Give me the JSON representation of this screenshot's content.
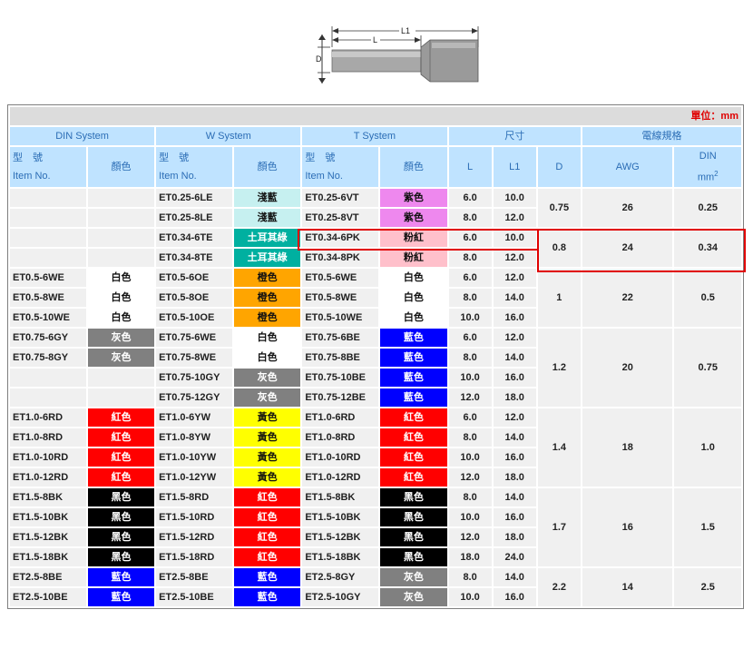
{
  "diagram": {
    "label_l1": "L1",
    "label_l": "L",
    "label_d": "D"
  },
  "table": {
    "unit": "單位：mm",
    "groups": {
      "din": "DIN System",
      "w": "W System",
      "t": "T System",
      "size": "尺寸",
      "wire": "電線規格"
    },
    "headers": {
      "item_zh": "型　號",
      "item_en": "Item No.",
      "color": "顏色",
      "L": "L",
      "L1": "L1",
      "D": "D",
      "awg": "AWG",
      "din": "DIN",
      "din_unit": "mm",
      "din_sup": "2"
    },
    "colors": {
      "浅藍": "#c6f0f0",
      "土耳其綠": "#00b0a0",
      "紫色": "#ee88ee",
      "粉紅": "#ffc0cb",
      "白色": "#ffffff",
      "橙色": "#ffa500",
      "灰色": "#808080",
      "藍色": "#0000ff",
      "紅色": "#ff0000",
      "黃色": "#ffff00",
      "黑色": "#000000"
    },
    "rows": [
      {
        "din": "",
        "din_c": "",
        "w": "ET0.25-6LE",
        "w_c": "淺藍",
        "t": "ET0.25-6VT",
        "t_c": "紫色",
        "L": "6.0",
        "L1": "10.0",
        "ck": "浅藍",
        "tk": "紫色"
      },
      {
        "din": "",
        "din_c": "",
        "w": "ET0.25-8LE",
        "w_c": "淺藍",
        "t": "ET0.25-8VT",
        "t_c": "紫色",
        "L": "8.0",
        "L1": "12.0",
        "ck": "浅藍",
        "tk": "紫色"
      },
      {
        "din": "",
        "din_c": "",
        "w": "ET0.34-6TE",
        "w_c": "土耳其綠",
        "t": "ET0.34-6PK",
        "t_c": "粉紅",
        "L": "6.0",
        "L1": "10.0",
        "ck": "土耳其綠",
        "tk": "粉紅"
      },
      {
        "din": "",
        "din_c": "",
        "w": "ET0.34-8TE",
        "w_c": "土耳其綠",
        "t": "ET0.34-8PK",
        "t_c": "粉紅",
        "L": "8.0",
        "L1": "12.0",
        "ck": "土耳其綠",
        "tk": "粉紅"
      },
      {
        "din": "ET0.5-6WE",
        "din_c": "白色",
        "w": "ET0.5-6OE",
        "w_c": "橙色",
        "t": "ET0.5-6WE",
        "t_c": "白色",
        "L": "6.0",
        "L1": "12.0",
        "dk": "白色",
        "ck": "橙色",
        "tk": "白色"
      },
      {
        "din": "ET0.5-8WE",
        "din_c": "白色",
        "w": "ET0.5-8OE",
        "w_c": "橙色",
        "t": "ET0.5-8WE",
        "t_c": "白色",
        "L": "8.0",
        "L1": "14.0",
        "dk": "白色",
        "ck": "橙色",
        "tk": "白色"
      },
      {
        "din": "ET0.5-10WE",
        "din_c": "白色",
        "w": "ET0.5-10OE",
        "w_c": "橙色",
        "t": "ET0.5-10WE",
        "t_c": "白色",
        "L": "10.0",
        "L1": "16.0",
        "dk": "白色",
        "ck": "橙色",
        "tk": "白色"
      },
      {
        "din": "ET0.75-6GY",
        "din_c": "灰色",
        "w": "ET0.75-6WE",
        "w_c": "白色",
        "t": "ET0.75-6BE",
        "t_c": "藍色",
        "L": "6.0",
        "L1": "12.0",
        "dk": "灰色",
        "ck": "白色",
        "tk": "藍色"
      },
      {
        "din": "ET0.75-8GY",
        "din_c": "灰色",
        "w": "ET0.75-8WE",
        "w_c": "白色",
        "t": "ET0.75-8BE",
        "t_c": "藍色",
        "L": "8.0",
        "L1": "14.0",
        "dk": "灰色",
        "ck": "白色",
        "tk": "藍色"
      },
      {
        "din": "",
        "din_c": "",
        "w": "ET0.75-10GY",
        "w_c": "灰色",
        "t": "ET0.75-10BE",
        "t_c": "藍色",
        "L": "10.0",
        "L1": "16.0",
        "ck": "灰色",
        "tk": "藍色"
      },
      {
        "din": "",
        "din_c": "",
        "w": "ET0.75-12GY",
        "w_c": "灰色",
        "t": "ET0.75-12BE",
        "t_c": "藍色",
        "L": "12.0",
        "L1": "18.0",
        "ck": "灰色",
        "tk": "藍色"
      },
      {
        "din": "ET1.0-6RD",
        "din_c": "紅色",
        "w": "ET1.0-6YW",
        "w_c": "黃色",
        "t": "ET1.0-6RD",
        "t_c": "紅色",
        "L": "6.0",
        "L1": "12.0",
        "dk": "紅色",
        "ck": "黃色",
        "tk": "紅色"
      },
      {
        "din": "ET1.0-8RD",
        "din_c": "紅色",
        "w": "ET1.0-8YW",
        "w_c": "黃色",
        "t": "ET1.0-8RD",
        "t_c": "紅色",
        "L": "8.0",
        "L1": "14.0",
        "dk": "紅色",
        "ck": "黃色",
        "tk": "紅色"
      },
      {
        "din": "ET1.0-10RD",
        "din_c": "紅色",
        "w": "ET1.0-10YW",
        "w_c": "黃色",
        "t": "ET1.0-10RD",
        "t_c": "紅色",
        "L": "10.0",
        "L1": "16.0",
        "dk": "紅色",
        "ck": "黃色",
        "tk": "紅色"
      },
      {
        "din": "ET1.0-12RD",
        "din_c": "紅色",
        "w": "ET1.0-12YW",
        "w_c": "黃色",
        "t": "ET1.0-12RD",
        "t_c": "紅色",
        "L": "12.0",
        "L1": "18.0",
        "dk": "紅色",
        "ck": "黃色",
        "tk": "紅色"
      },
      {
        "din": "ET1.5-8BK",
        "din_c": "黑色",
        "w": "ET1.5-8RD",
        "w_c": "紅色",
        "t": "ET1.5-8BK",
        "t_c": "黑色",
        "L": "8.0",
        "L1": "14.0",
        "dk": "黑色",
        "ck": "紅色",
        "tk": "黑色"
      },
      {
        "din": "ET1.5-10BK",
        "din_c": "黑色",
        "w": "ET1.5-10RD",
        "w_c": "紅色",
        "t": "ET1.5-10BK",
        "t_c": "黑色",
        "L": "10.0",
        "L1": "16.0",
        "dk": "黑色",
        "ck": "紅色",
        "tk": "黑色"
      },
      {
        "din": "ET1.5-12BK",
        "din_c": "黑色",
        "w": "ET1.5-12RD",
        "w_c": "紅色",
        "t": "ET1.5-12BK",
        "t_c": "黑色",
        "L": "12.0",
        "L1": "18.0",
        "dk": "黑色",
        "ck": "紅色",
        "tk": "黑色"
      },
      {
        "din": "ET1.5-18BK",
        "din_c": "黑色",
        "w": "ET1.5-18RD",
        "w_c": "紅色",
        "t": "ET1.5-18BK",
        "t_c": "黑色",
        "L": "18.0",
        "L1": "24.0",
        "dk": "黑色",
        "ck": "紅色",
        "tk": "黑色"
      },
      {
        "din": "ET2.5-8BE",
        "din_c": "藍色",
        "w": "ET2.5-8BE",
        "w_c": "藍色",
        "t": "ET2.5-8GY",
        "t_c": "灰色",
        "L": "8.0",
        "L1": "14.0",
        "dk": "藍色",
        "ck": "藍色",
        "tk": "灰色"
      },
      {
        "din": "ET2.5-10BE",
        "din_c": "藍色",
        "w": "ET2.5-10BE",
        "w_c": "藍色",
        "t": "ET2.5-10GY",
        "t_c": "灰色",
        "L": "10.0",
        "L1": "16.0",
        "dk": "藍色",
        "ck": "藍色",
        "tk": "灰色"
      }
    ],
    "groups_spec": [
      {
        "D": "0.75",
        "AWG": "26",
        "DIN": "0.25",
        "span": 2
      },
      {
        "D": "0.8",
        "AWG": "24",
        "DIN": "0.34",
        "span": 2
      },
      {
        "D": "1",
        "AWG": "22",
        "DIN": "0.5",
        "span": 3
      },
      {
        "D": "1.2",
        "AWG": "20",
        "DIN": "0.75",
        "span": 4
      },
      {
        "D": "1.4",
        "AWG": "18",
        "DIN": "1.0",
        "span": 4
      },
      {
        "D": "1.7",
        "AWG": "16",
        "DIN": "1.5",
        "span": 4
      },
      {
        "D": "2.2",
        "AWG": "14",
        "DIN": "2.5",
        "span": 3
      }
    ]
  }
}
